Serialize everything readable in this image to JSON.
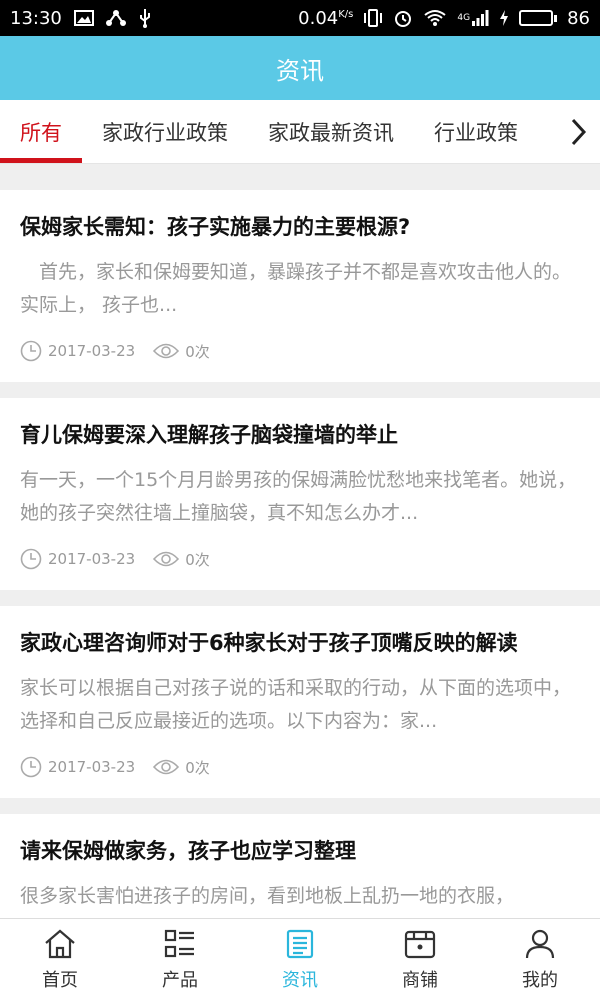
{
  "status_bar": {
    "time": "13:30",
    "speed": "0.04",
    "speed_unit": "K/s",
    "network": "4G",
    "battery": "86",
    "battery_level": 0.86,
    "battery_color": "#4cd44c"
  },
  "app_bar": {
    "title": "资讯",
    "color": "#5bc9e6"
  },
  "tabs": [
    {
      "label": "所有",
      "active": true
    },
    {
      "label": "家政行业政策"
    },
    {
      "label": "家政最新资讯"
    },
    {
      "label": "行业政策"
    }
  ],
  "accent_color": "#d0121b",
  "articles": [
    {
      "title": "保姆家长需知：孩子实施暴力的主要根源?",
      "desc": "　首先，家长和保姆要知道，暴躁孩子并不都是喜欢攻击他人的。实际上， 孩子也...",
      "date": "2017-03-23",
      "views": "0次"
    },
    {
      "title": "育儿保姆要深入理解孩子脑袋撞墙的举止",
      "desc": "有一天，一个15个月月龄男孩的保姆满脸忧愁地来找笔者。她说，她的孩子突然往墙上撞脑袋，真不知怎么办才...",
      "date": "2017-03-23",
      "views": "0次"
    },
    {
      "title": "家政心理咨询师对于6种家长对于孩子顶嘴反映的解读",
      "desc": "家长可以根据自己对孩子说的话和采取的行动，从下面的选项中，选择和自己反应最接近的选项。以下内容为：家...",
      "date": "2017-03-23",
      "views": "0次"
    },
    {
      "title": "请来保姆做家务，孩子也应学习整理",
      "desc": "很多家长害怕进孩子的房间，看到地板上乱扔一地的衣服，",
      "date": "",
      "views": ""
    }
  ],
  "bottom_nav": {
    "active_color": "#2ab6dc",
    "items": [
      {
        "label": "首页",
        "icon": "home-icon"
      },
      {
        "label": "产品",
        "icon": "grid-list-icon"
      },
      {
        "label": "资讯",
        "icon": "news-icon",
        "active": true
      },
      {
        "label": "商铺",
        "icon": "store-icon"
      },
      {
        "label": "我的",
        "icon": "user-icon"
      }
    ]
  }
}
